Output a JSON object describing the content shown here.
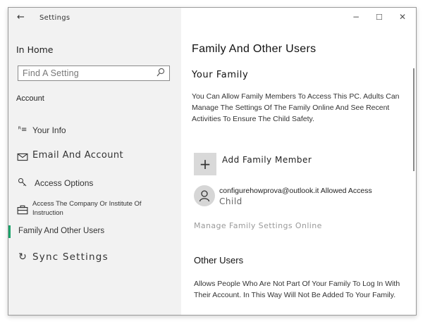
{
  "window": {
    "title": "Settings",
    "controls": {
      "minimize": "−",
      "maximize": "☐",
      "close": "✕"
    }
  },
  "sidebar": {
    "home": "In Home",
    "search": {
      "placeholder": "Find A Setting"
    },
    "section_label": "Account",
    "items": [
      {
        "label": "Your Info",
        "icon": "user-list-icon"
      },
      {
        "label": "Email And Account",
        "icon": "mail-icon"
      },
      {
        "label": "Access Options",
        "icon": "key-icon"
      },
      {
        "label": "Access The Company Or Institute Of Instruction",
        "icon": "briefcase-icon"
      },
      {
        "label": "Family And Other Users",
        "icon": "family-icon",
        "selected": true
      },
      {
        "label": "Sync Settings",
        "icon": "sync-icon"
      }
    ]
  },
  "main": {
    "title": "Family And Other Users",
    "your_family": {
      "heading": "Your Family",
      "description": "You Can Allow Family Members To Access This PC. Adults Can Manage The Settings Of The Family Online And See Recent Activities To Ensure The Child Safety.",
      "add_member": "Add Family Member",
      "member_email": "configurehowprova@outlook.it Allowed Access",
      "member_role": "Child",
      "manage_link": "Manage Family Settings Online"
    },
    "other_users": {
      "heading": "Other Users",
      "description": "Allows People Who Are Not Part Of Your Family To Log In With Their Account. In This Way Will Not Be Added To Your Family."
    }
  },
  "colors": {
    "accent": "#1aa36a",
    "sidebar_bg": "#f2f2f2"
  }
}
